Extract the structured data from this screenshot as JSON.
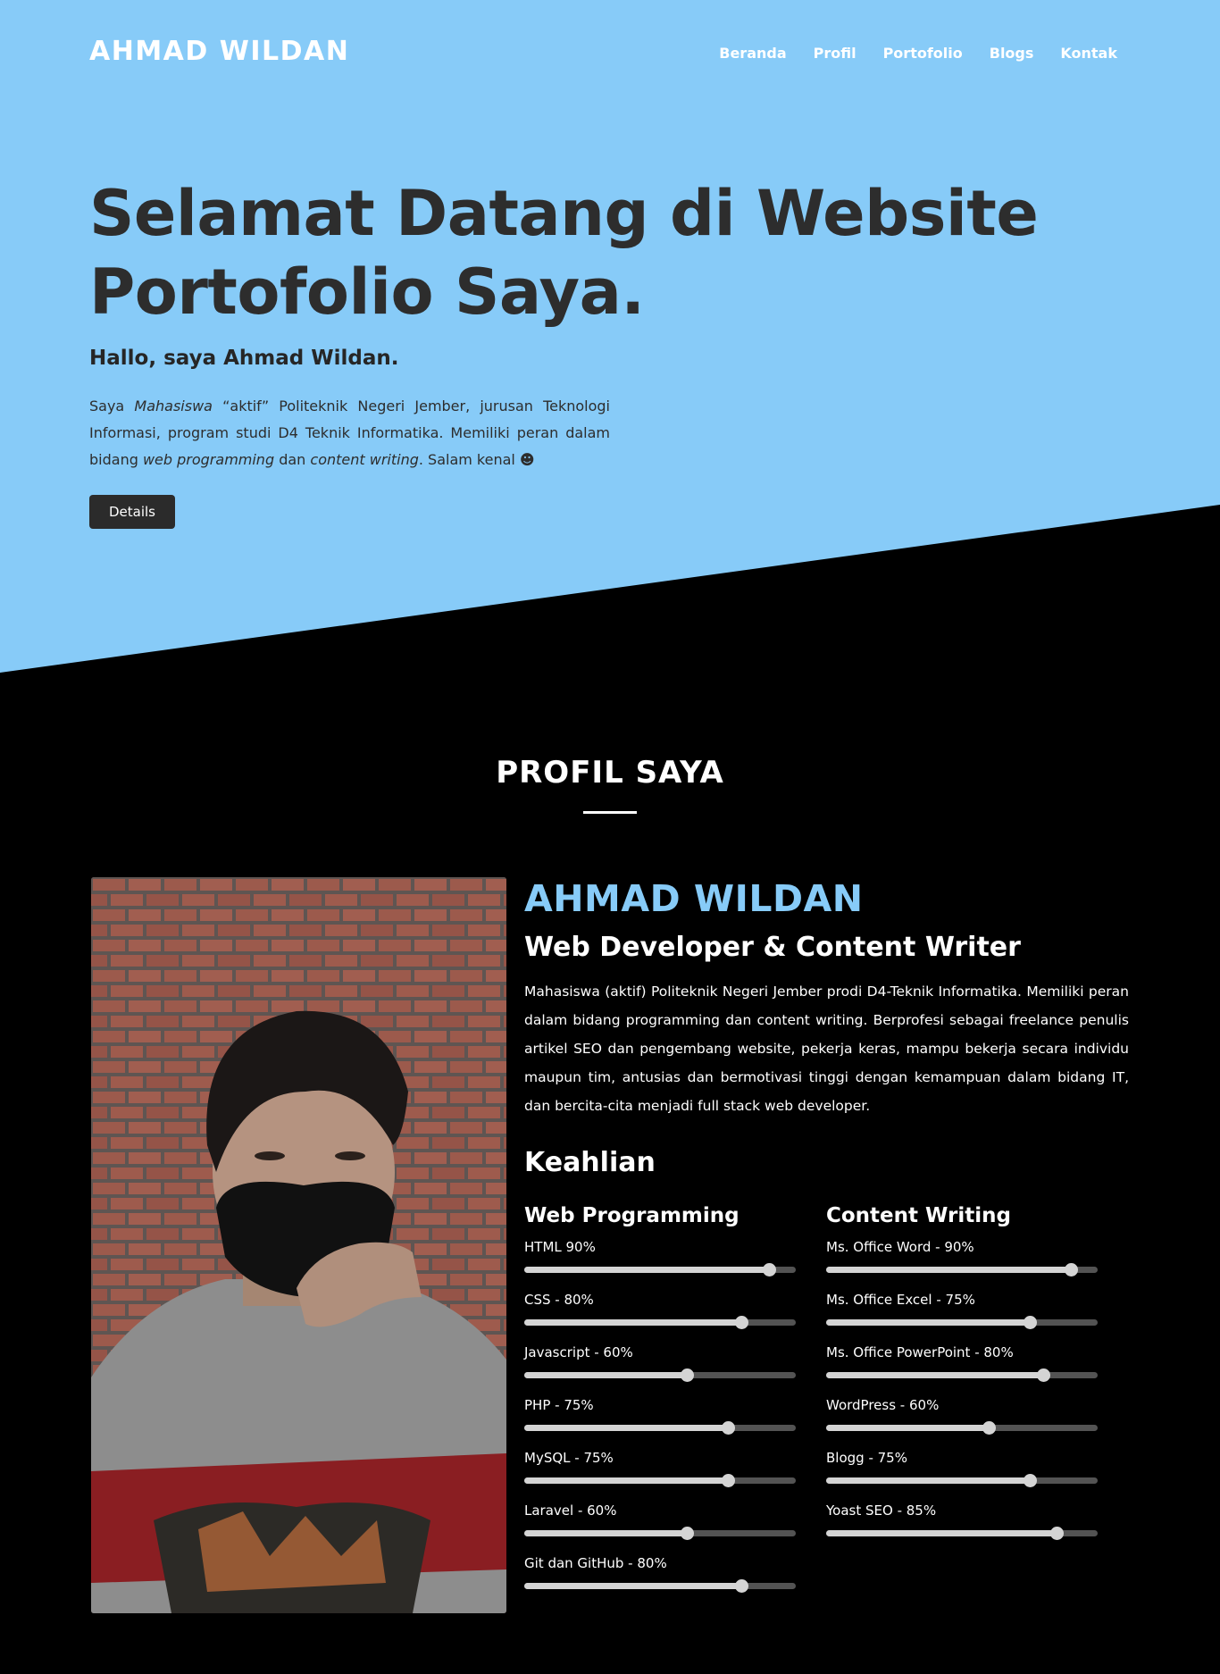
{
  "nav": {
    "brand": "AHMAD WILDAN",
    "items": [
      "Beranda",
      "Profil",
      "Portofolio",
      "Blogs",
      "Kontak"
    ]
  },
  "hero": {
    "title_line1": "Selamat Datang di Website",
    "title_line2": "Portofolio Saya.",
    "subtitle": "Hallo, saya Ahmad Wildan.",
    "text_1": "Saya ",
    "text_em1": "Mahasiswa",
    "text_2": " “aktif” Politeknik Negeri Jember, jurusan Teknologi Informasi, program studi D4 Teknik Informatika. Memiliki peran dalam bidang ",
    "text_em2": "web programming",
    "text_3": " dan ",
    "text_em3": "content writing",
    "text_4": ". Salam kenal ☻",
    "button": "Details"
  },
  "profile": {
    "section_title": "PROFIL SAYA",
    "name": "AHMAD WILDAN",
    "role": "Web Developer & Content Writer",
    "description": "Mahasiswa (aktif) Politeknik Negeri Jember prodi D4-Teknik Informatika. Memiliki peran dalam bidang programming dan content writing. Berprofesi sebagai freelance penulis artikel SEO dan pengembang website, pekerja keras, mampu bekerja secara individu maupun tim, antusias dan bermotivasi tinggi dengan kemampuan dalam bidang IT, dan bercita-cita menjadi full stack web developer."
  },
  "skills": {
    "title": "Keahlian",
    "web": {
      "title": "Web Programming",
      "items": [
        {
          "label": "HTML 90%",
          "value": 90
        },
        {
          "label": "CSS - 80%",
          "value": 80
        },
        {
          "label": "Javascript - 60%",
          "value": 60
        },
        {
          "label": "PHP - 75%",
          "value": 75
        },
        {
          "label": "MySQL - 75%",
          "value": 75
        },
        {
          "label": "Laravel - 60%",
          "value": 60
        },
        {
          "label": "Git dan GitHub - 80%",
          "value": 80
        }
      ]
    },
    "content": {
      "title": "Content Writing",
      "items": [
        {
          "label": "Ms. Office Word - 90%",
          "value": 90
        },
        {
          "label": "Ms. Office Excel - 75%",
          "value": 75
        },
        {
          "label": "Ms. Office PowerPoint - 80%",
          "value": 80
        },
        {
          "label": "WordPress - 60%",
          "value": 60
        },
        {
          "label": "Blogg - 75%",
          "value": 75
        },
        {
          "label": "Yoast SEO - 85%",
          "value": 85
        }
      ]
    }
  },
  "colors": {
    "hero_bg": "#87cbf8",
    "accent": "#87cbf8",
    "page_bg": "#000000",
    "button_bg": "#2b2b2b"
  }
}
